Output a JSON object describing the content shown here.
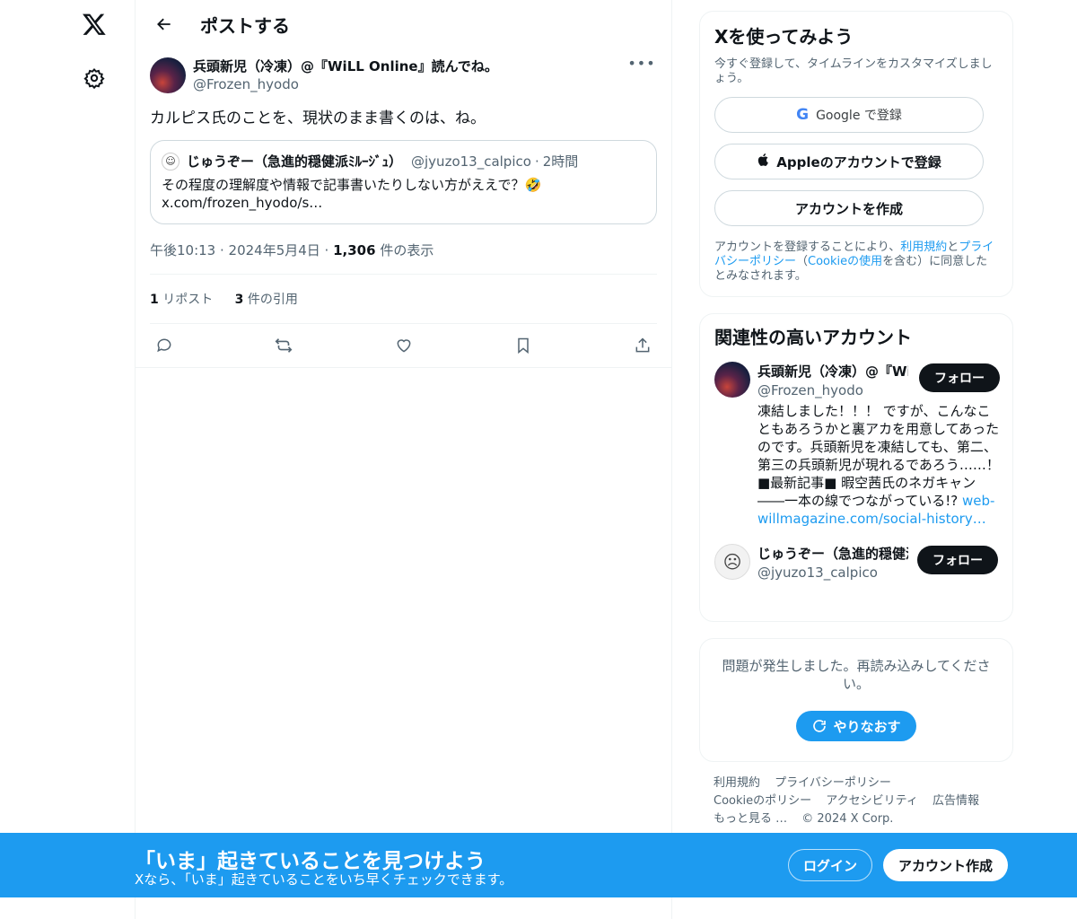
{
  "nav": {
    "logo_icon": "x-logo-icon",
    "settings_icon": "gear-icon"
  },
  "header": {
    "title": "ポストする"
  },
  "post": {
    "author_name": "兵頭新児（冷凍）@『WiLL Online』読んでね。",
    "author_handle": "@Frozen_hyodo",
    "text": "カルピス氏のことを、現状のまま書くのは、ね。",
    "quote": {
      "name": "じゅうぞー（急進的穏健派ﾐﾙｰｼﾞｭ）",
      "handle": "@jyuzo13_calpico",
      "sep": "·",
      "time": "2時間",
      "text_line1": "その程度の理解度や情報で記事書いたりしない方がええで？🤣",
      "text_line2": "x.com/frozen_hyodo/s…"
    },
    "meta_time": "午後10:13 · 2024年5月4日 · ",
    "views_count": "1,306",
    "views_label": " 件の表示",
    "reposts_count": "1",
    "reposts_label": " リポスト",
    "quotes_count": "3",
    "quotes_label": " 件の引用"
  },
  "signup_card": {
    "title": "Xを使ってみよう",
    "subtitle": "今すぐ登録して、タイムラインをカスタマイズしましょう。",
    "google_label": "Google で登録",
    "apple_label": "Appleのアカウントで登録",
    "create_label": "アカウントを作成",
    "legal_pre": "アカウントを登録することにより、",
    "legal_terms": "利用規約",
    "legal_and": "と",
    "legal_privacy": "プライバシーポリシー",
    "legal_mid": "（",
    "legal_cookie": "Cookieの使用",
    "legal_post": "を含む）に同意したとみなされます。"
  },
  "relevant": {
    "title": "関連性の高いアカウント",
    "accounts": [
      {
        "name": "兵頭新児（冷凍）@『WiLL Online』読んでね。",
        "handle": "@Frozen_hyodo",
        "bio": "凍結しました！！！ ですが、こんなこともあろうかと裏アカを用意してあったのです。兵頭新児を凍結しても、第二、第三の兵頭新児が現れるであろう……！ ■最新記事■ 暇空茜氏のネガキャン――一本の線でつながっている!?",
        "link": "web-willmagazine.com/social-history…",
        "follow_label": "フォロー"
      },
      {
        "name": "じゅうぞー（急進的穏健派ﾐﾙｰｼﾞｭ）",
        "handle": "@jyuzo13_calpico",
        "follow_label": "フォロー"
      }
    ]
  },
  "error_card": {
    "message": "問題が発生しました。再読み込みしてください。",
    "retry_label": "やりなおす"
  },
  "footer": {
    "items": [
      "利用規約",
      "プライバシーポリシー",
      "Cookieのポリシー",
      "アクセシビリティ",
      "広告情報",
      "もっと見る …",
      "© 2024 X Corp."
    ]
  },
  "banner": {
    "title": "「いま」起きていることを見つけよう",
    "subtitle": "Xなら、「いま」起きていることをいち早くチェックできます。",
    "login_label": "ログイン",
    "signup_label": "アカウント作成"
  },
  "colors": {
    "accent": "#1d9bf0",
    "text": "#0f1419",
    "muted": "#536471",
    "border": "#eff3f4"
  }
}
